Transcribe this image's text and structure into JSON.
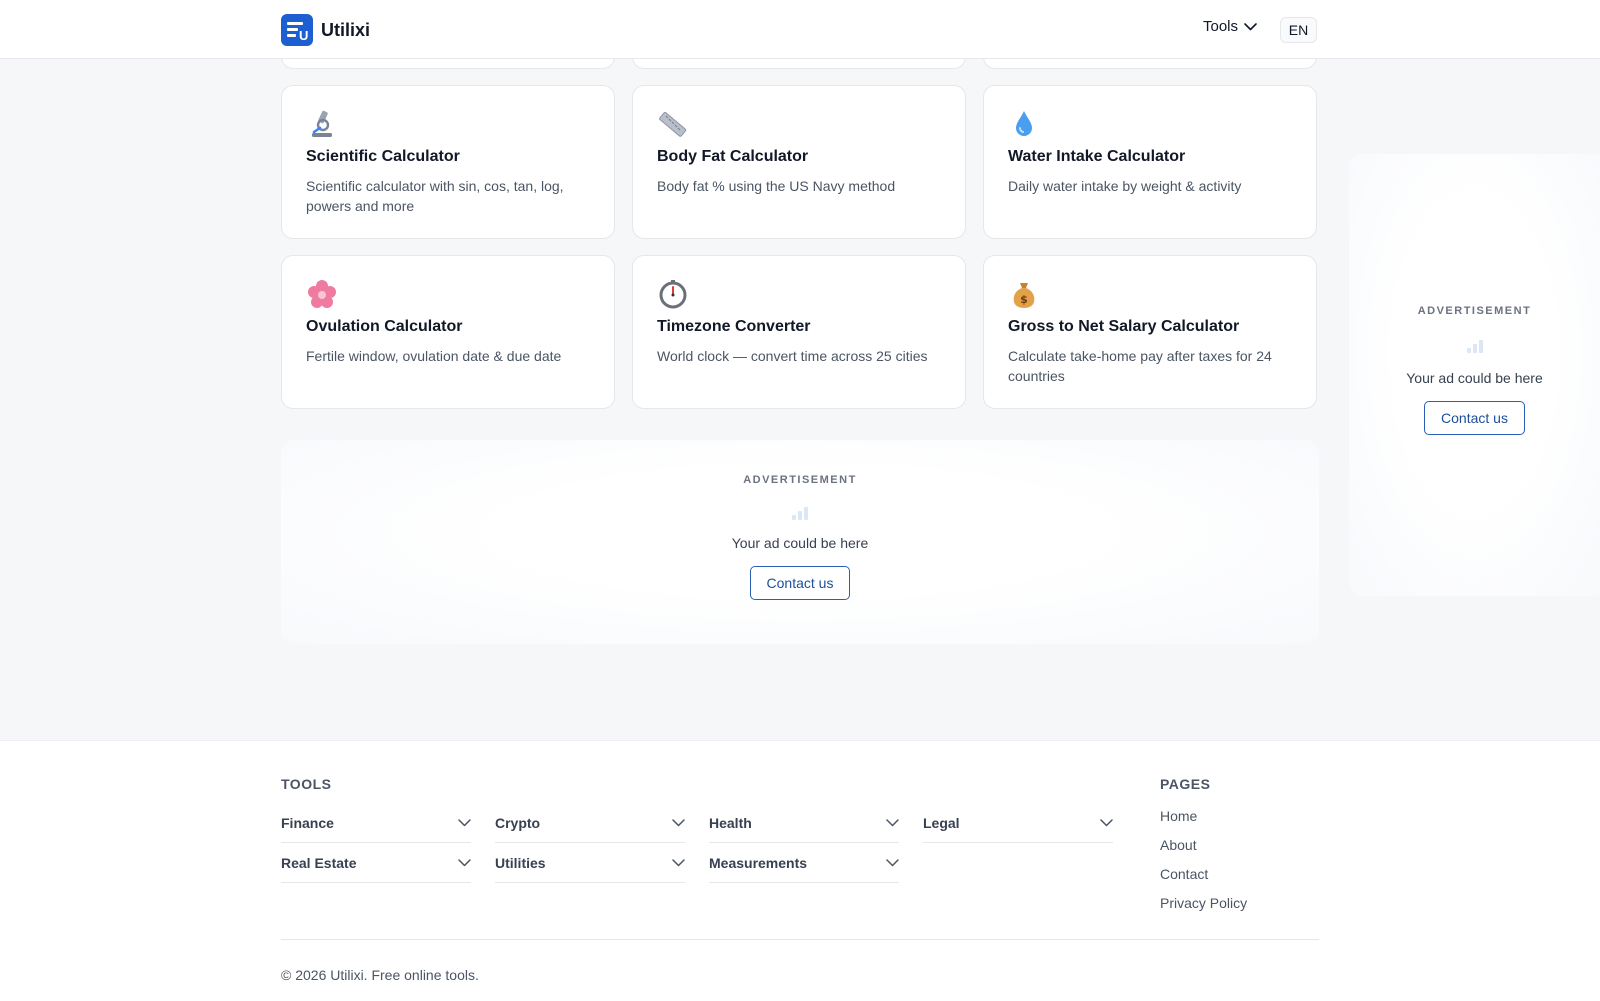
{
  "header": {
    "brand": "Utilixi",
    "logo_letter": "U",
    "tools_label": "Tools",
    "lang": "EN"
  },
  "cards": [
    {
      "icon": "microscope-icon",
      "title": "Scientific Calculator",
      "desc": "Scientific calculator with sin, cos, tan, log, powers and more"
    },
    {
      "icon": "ruler-icon",
      "title": "Body Fat Calculator",
      "desc": "Body fat % using the US Navy method"
    },
    {
      "icon": "droplet-icon",
      "title": "Water Intake Calculator",
      "desc": "Daily water intake by weight & activity"
    },
    {
      "icon": "flower-icon",
      "title": "Ovulation Calculator",
      "desc": "Fertile window, ovulation date & due date"
    },
    {
      "icon": "stopwatch-icon",
      "title": "Timezone Converter",
      "desc": "World clock — convert time across 25 cities"
    },
    {
      "icon": "money-bag-icon",
      "title": "Gross to Net Salary Calculator",
      "desc": "Calculate take-home pay after taxes for 24 countries"
    }
  ],
  "ad": {
    "label": "ADVERTISEMENT",
    "text": "Your ad could be here",
    "button": "Contact us"
  },
  "footer": {
    "tools_heading": "TOOLS",
    "categories": [
      "Finance",
      "Crypto",
      "Health",
      "Legal",
      "Real Estate",
      "Utilities",
      "Measurements"
    ],
    "pages_heading": "PAGES",
    "pages": [
      "Home",
      "About",
      "Contact",
      "Privacy Policy"
    ],
    "copyright": "© 2026 Utilixi. Free online tools."
  },
  "colors": {
    "accent": "#1d5fd1",
    "background": "#f6f7f9"
  }
}
